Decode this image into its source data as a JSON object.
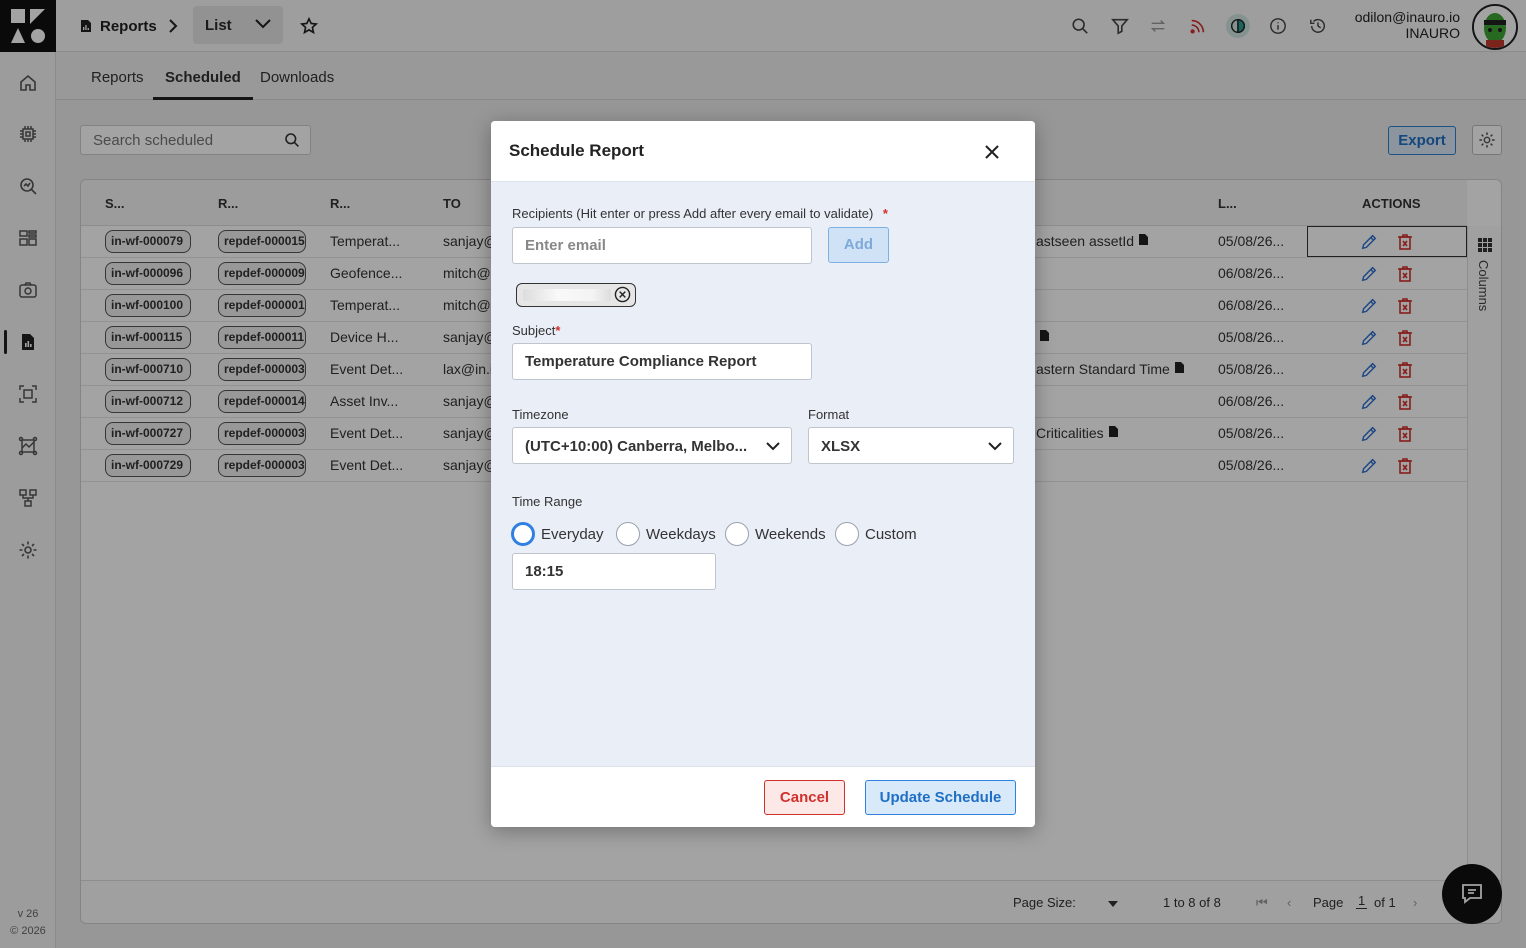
{
  "app": {
    "version": "v 26",
    "copyright": "© 2026"
  },
  "breadcrumb": {
    "root": "Reports",
    "current": "List"
  },
  "user": {
    "email": "odilon@inauro.io",
    "org": "INAURO"
  },
  "tabs": [
    {
      "label": "Reports",
      "active": false
    },
    {
      "label": "Scheduled",
      "active": true
    },
    {
      "label": "Downloads",
      "active": false
    }
  ],
  "toolbar": {
    "search_placeholder": "Search scheduled",
    "export_label": "Export"
  },
  "grid": {
    "headers": {
      "s": "S...",
      "r1": "R...",
      "r2": "R...",
      "to": "TO",
      "l": "L...",
      "actions": "ACTIONS"
    },
    "columns_label": "Columns",
    "rows": [
      {
        "id": "in-wf-000079",
        "def": "repdef-000015",
        "name": "Temperat...",
        "to": "sanjay@",
        "extra": "astseen",
        "extra2": "assetId",
        "last": "05/08/26..."
      },
      {
        "id": "in-wf-000096",
        "def": "repdef-000009",
        "name": "Geofence...",
        "to": "mitch@i",
        "extra": "",
        "extra2": "",
        "last": "06/08/26..."
      },
      {
        "id": "in-wf-000100",
        "def": "repdef-000001",
        "name": "Temperat...",
        "to": "mitch@i",
        "extra": "",
        "extra2": "",
        "last": "06/08/26..."
      },
      {
        "id": "in-wf-000115",
        "def": "repdef-000011",
        "name": "Device H...",
        "to": "sanjay@",
        "extra": "",
        "extra2": "",
        "last": "05/08/26..."
      },
      {
        "id": "in-wf-000710",
        "def": "repdef-000003",
        "name": "Event Det...",
        "to": "lax@in.ic",
        "extra": "astern Standard Time",
        "extra2": "",
        "last": "05/08/26..."
      },
      {
        "id": "in-wf-000712",
        "def": "repdef-000014",
        "name": "Asset Inv...",
        "to": "sanjay@",
        "extra": "",
        "extra2": "",
        "last": "06/08/26..."
      },
      {
        "id": "in-wf-000727",
        "def": "repdef-000003",
        "name": "Event Det...",
        "to": "sanjay@",
        "extra": "Criticalities",
        "extra2": "",
        "last": "05/08/26..."
      },
      {
        "id": "in-wf-000729",
        "def": "repdef-000003",
        "name": "Event Det...",
        "to": "sanjay@",
        "extra": "",
        "extra2": "",
        "last": "05/08/26..."
      }
    ]
  },
  "pagination": {
    "page_size_label": "Page Size:",
    "range": "1 to 8 of 8",
    "page_label": "Page",
    "page": "1",
    "of": "of 1"
  },
  "modal": {
    "title": "Schedule Report",
    "recipients_label": "Recipients (Hit enter or press Add after every email to validate)",
    "recipients_required": "*",
    "email_placeholder": "Enter email",
    "add_label": "Add",
    "subject_label": "Subject",
    "subject_required": "*",
    "subject_value": "Temperature Compliance Report",
    "timezone_label": "Timezone",
    "timezone_value": "(UTC+10:00) Canberra, Melbo...",
    "format_label": "Format",
    "format_value": "XLSX",
    "time_range_label": "Time Range",
    "time_range_options": [
      "Everyday",
      "Weekdays",
      "Weekends",
      "Custom"
    ],
    "time_range_selected": "Everyday",
    "time_value": "18:15",
    "cancel_label": "Cancel",
    "update_label": "Update Schedule"
  },
  "colors": {
    "accent": "#2f80e0",
    "danger": "#d0312d",
    "edit": "#2f6fd1"
  }
}
